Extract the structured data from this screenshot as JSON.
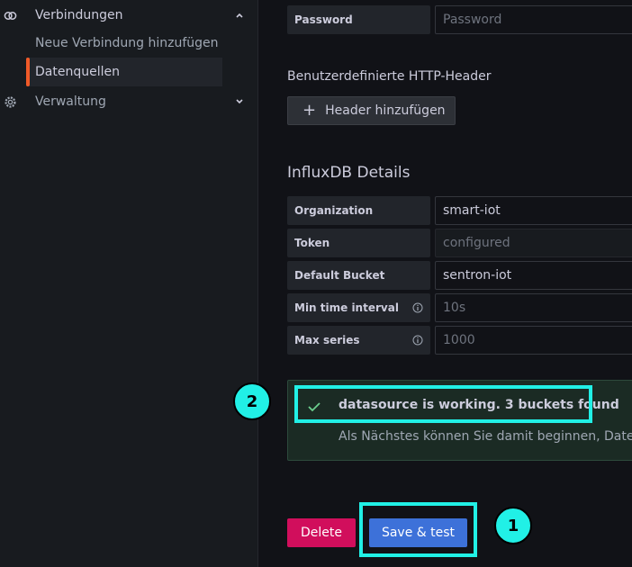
{
  "sidebar": {
    "connections_label": "Verbindungen",
    "items": [
      {
        "label": "Neue Verbindung hinzufügen"
      },
      {
        "label": "Datenquellen"
      }
    ],
    "administration_label": "Verwaltung"
  },
  "form": {
    "password": {
      "label": "Password",
      "placeholder": "Password"
    },
    "custom_headers_heading": "Benutzerdefinierte HTTP-Header",
    "add_header_button": "Header hinzufügen",
    "details_heading": "InfluxDB Details",
    "organization": {
      "label": "Organization",
      "value": "smart-iot"
    },
    "token": {
      "label": "Token",
      "value": "configured"
    },
    "default_bucket": {
      "label": "Default Bucket",
      "value": "sentron-iot"
    },
    "min_time_interval": {
      "label": "Min time interval",
      "placeholder": "10s"
    },
    "max_series": {
      "label": "Max series",
      "placeholder": "1000"
    }
  },
  "alert": {
    "title": "datasource is working. 3 buckets found",
    "text": "Als Nächstes können Sie damit beginnen, Daten"
  },
  "annotations": {
    "marker_1": "1",
    "marker_2": "2"
  },
  "buttons": {
    "delete": "Delete",
    "save_test": "Save & test"
  },
  "colors": {
    "accent_orange": "#f05a28",
    "highlight_cyan": "#21f0e6",
    "delete_red": "#d10e5c",
    "primary_blue": "#3d71d9",
    "success_green": "#6ccf8e"
  }
}
